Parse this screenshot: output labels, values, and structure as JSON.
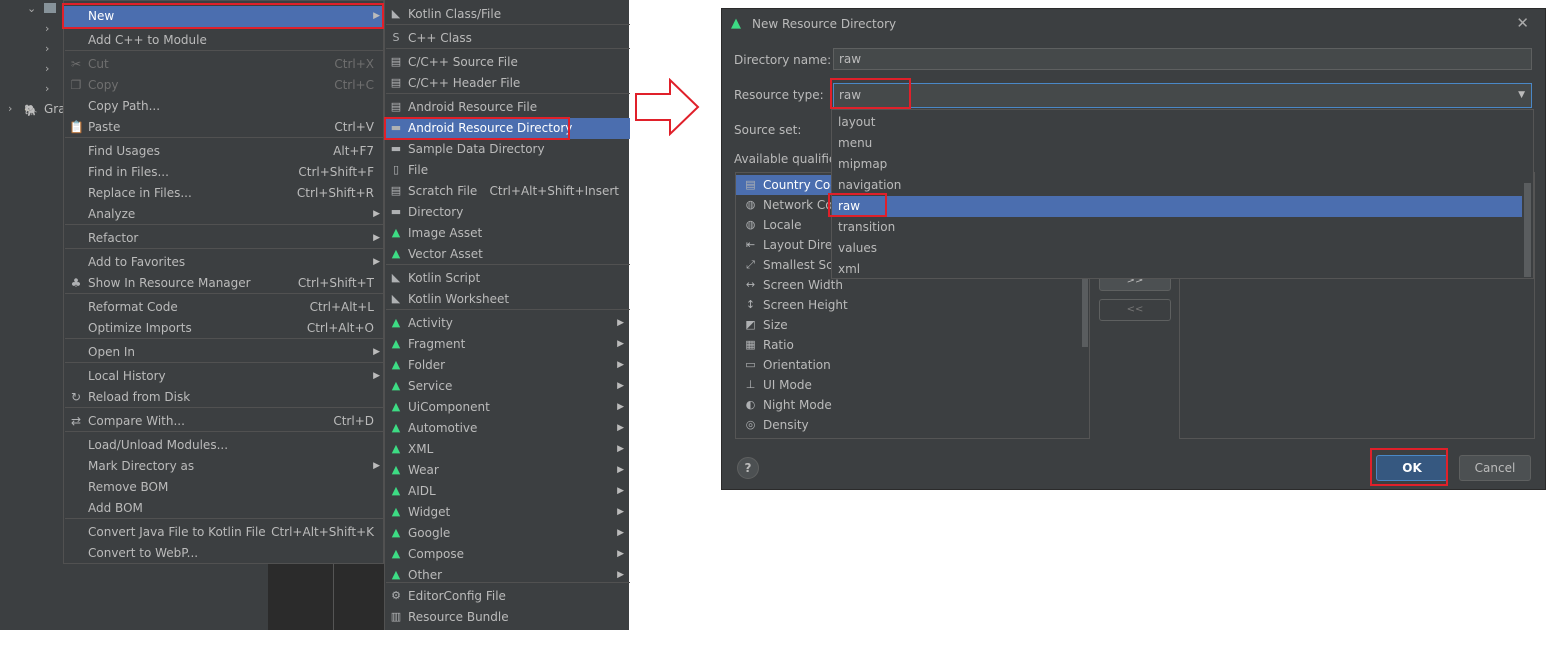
{
  "context_menu": {
    "items": [
      {
        "label": "New",
        "shortcut": "",
        "submenu": true,
        "selected": true,
        "icon": "none"
      },
      {
        "label": "Add C++ to Module",
        "shortcut": "",
        "submenu": false,
        "icon": "none"
      },
      {
        "label": "Cut",
        "shortcut": "Ctrl+X",
        "disabled": true,
        "icon": "scissors-icon"
      },
      {
        "label": "Copy",
        "shortcut": "Ctrl+C",
        "disabled": true,
        "icon": "copy-icon"
      },
      {
        "label": "Copy Path...",
        "shortcut": "",
        "icon": "none"
      },
      {
        "label": "Paste",
        "shortcut": "Ctrl+V",
        "icon": "clipboard-icon"
      },
      {
        "label": "Find Usages",
        "shortcut": "Alt+F7",
        "icon": "none"
      },
      {
        "label": "Find in Files...",
        "shortcut": "Ctrl+Shift+F",
        "icon": "none"
      },
      {
        "label": "Replace in Files...",
        "shortcut": "Ctrl+Shift+R",
        "icon": "none"
      },
      {
        "label": "Analyze",
        "shortcut": "",
        "submenu": true,
        "icon": "none"
      },
      {
        "label": "Refactor",
        "shortcut": "",
        "submenu": true,
        "icon": "none"
      },
      {
        "label": "Add to Favorites",
        "shortcut": "",
        "submenu": true,
        "icon": "none"
      },
      {
        "label": "Show In Resource Manager",
        "shortcut": "Ctrl+Shift+T",
        "icon": "resource-manager-icon"
      },
      {
        "label": "Reformat Code",
        "shortcut": "Ctrl+Alt+L",
        "icon": "none"
      },
      {
        "label": "Optimize Imports",
        "shortcut": "Ctrl+Alt+O",
        "icon": "none"
      },
      {
        "label": "Open In",
        "shortcut": "",
        "submenu": true,
        "icon": "none"
      },
      {
        "label": "Local History",
        "shortcut": "",
        "submenu": true,
        "icon": "none"
      },
      {
        "label": "Reload from Disk",
        "shortcut": "",
        "icon": "reload-icon"
      },
      {
        "label": "Compare With...",
        "shortcut": "Ctrl+D",
        "icon": "compare-icon"
      },
      {
        "label": "Load/Unload Modules...",
        "shortcut": "",
        "icon": "none"
      },
      {
        "label": "Mark Directory as",
        "shortcut": "",
        "submenu": true,
        "icon": "none"
      },
      {
        "label": "Remove BOM",
        "shortcut": "",
        "icon": "none"
      },
      {
        "label": "Add BOM",
        "shortcut": "",
        "icon": "none"
      },
      {
        "label": "Convert Java File to Kotlin File",
        "shortcut": "Ctrl+Alt+Shift+K",
        "icon": "none"
      },
      {
        "label": "Convert to WebP...",
        "shortcut": "",
        "icon": "none"
      }
    ]
  },
  "tree_partial_label": "Gra",
  "new_submenu": {
    "items": [
      {
        "label": "Kotlin Class/File",
        "shortcut": "",
        "icon": "kotlin-class-icon"
      },
      {
        "label": "C++ Class",
        "shortcut": "",
        "icon": "cpp-class-icon"
      },
      {
        "label": "C/C++ Source File",
        "shortcut": "",
        "icon": "cpp-source-icon"
      },
      {
        "label": "C/C++ Header File",
        "shortcut": "",
        "icon": "cpp-header-icon"
      },
      {
        "label": "Android Resource File",
        "shortcut": "",
        "icon": "resource-file-icon"
      },
      {
        "label": "Android Resource Directory",
        "shortcut": "",
        "icon": "folder-icon",
        "selected": true
      },
      {
        "label": "Sample Data Directory",
        "shortcut": "",
        "icon": "folder-icon"
      },
      {
        "label": "File",
        "shortcut": "",
        "icon": "file-icon"
      },
      {
        "label": "Scratch File",
        "shortcut": "Ctrl+Alt+Shift+Insert",
        "icon": "scratch-file-icon"
      },
      {
        "label": "Directory",
        "shortcut": "",
        "icon": "folder-icon"
      },
      {
        "label": "Image Asset",
        "shortcut": "",
        "icon": "android-icon"
      },
      {
        "label": "Vector Asset",
        "shortcut": "",
        "icon": "android-icon"
      },
      {
        "label": "Kotlin Script",
        "shortcut": "",
        "icon": "kotlin-script-icon"
      },
      {
        "label": "Kotlin Worksheet",
        "shortcut": "",
        "icon": "kotlin-worksheet-icon"
      },
      {
        "label": "Activity",
        "submenu": true,
        "icon": "android-icon"
      },
      {
        "label": "Fragment",
        "submenu": true,
        "icon": "android-icon"
      },
      {
        "label": "Folder",
        "submenu": true,
        "icon": "android-icon"
      },
      {
        "label": "Service",
        "submenu": true,
        "icon": "android-icon"
      },
      {
        "label": "UiComponent",
        "submenu": true,
        "icon": "android-icon"
      },
      {
        "label": "Automotive",
        "submenu": true,
        "icon": "android-icon"
      },
      {
        "label": "XML",
        "submenu": true,
        "icon": "android-icon"
      },
      {
        "label": "Wear",
        "submenu": true,
        "icon": "android-icon"
      },
      {
        "label": "AIDL",
        "submenu": true,
        "icon": "android-icon"
      },
      {
        "label": "Widget",
        "submenu": true,
        "icon": "android-icon"
      },
      {
        "label": "Google",
        "submenu": true,
        "icon": "android-icon"
      },
      {
        "label": "Compose",
        "submenu": true,
        "icon": "android-icon"
      },
      {
        "label": "Other",
        "submenu": true,
        "icon": "android-icon"
      },
      {
        "label": "EditorConfig File",
        "shortcut": "",
        "icon": "gear-icon"
      },
      {
        "label": "Resource Bundle",
        "shortcut": "",
        "icon": "resource-bundle-icon"
      }
    ]
  },
  "dialog": {
    "title": "New Resource Directory",
    "directory_name_label": "Directory name:",
    "directory_name_value": "raw",
    "resource_type_label": "Resource type:",
    "resource_type_value": "raw",
    "source_set_label": "Source set:",
    "available_qualifiers_label": "Available qualifier",
    "resource_type_options": [
      "layout",
      "menu",
      "mipmap",
      "navigation",
      "raw",
      "transition",
      "values",
      "xml"
    ],
    "qualifiers": [
      {
        "label": "Country Cod",
        "icon": "country-code-icon"
      },
      {
        "label": "Network Co",
        "icon": "network-code-icon"
      },
      {
        "label": "Locale",
        "icon": "globe-icon"
      },
      {
        "label": "Layout Direc",
        "icon": "layout-direction-icon"
      },
      {
        "label": "Smallest Scr",
        "icon": "smallest-screen-icon"
      },
      {
        "label": "Screen Width",
        "icon": "screen-width-icon"
      },
      {
        "label": "Screen Height",
        "icon": "screen-height-icon"
      },
      {
        "label": "Size",
        "icon": "size-icon"
      },
      {
        "label": "Ratio",
        "icon": "ratio-icon"
      },
      {
        "label": "Orientation",
        "icon": "orientation-icon"
      },
      {
        "label": "UI Mode",
        "icon": "ui-mode-icon"
      },
      {
        "label": "Night Mode",
        "icon": "night-mode-icon"
      },
      {
        "label": "Density",
        "icon": "density-icon"
      }
    ],
    "add_button": ">>",
    "remove_button": "<<",
    "help_button": "?",
    "ok_button": "OK",
    "cancel_button": "Cancel",
    "close_glyph": "✕"
  },
  "colors": {
    "selection": "#4b6eaf",
    "highlight_box": "#e0202a",
    "android_green": "#3ddc84"
  }
}
